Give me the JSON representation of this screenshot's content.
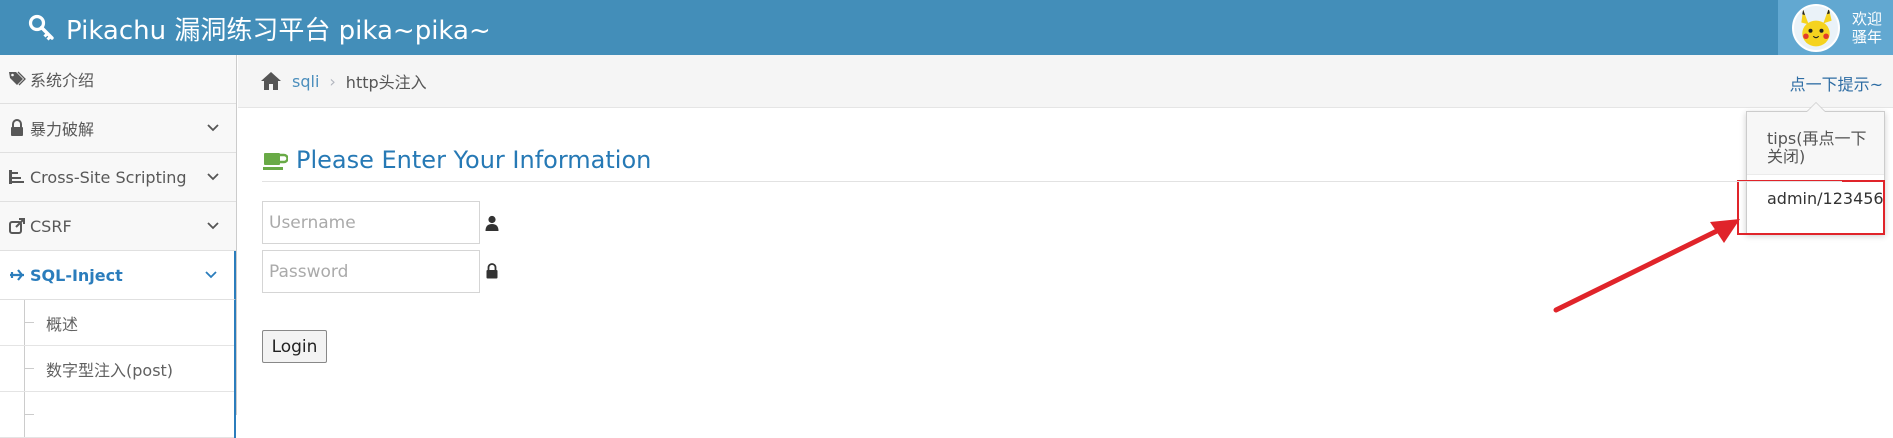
{
  "navbar": {
    "brand": "Pikachu 漏洞练习平台 pika~pika~",
    "brand_icon": "key-icon",
    "welcome_line1": "欢迎",
    "welcome_line2": "骚年",
    "background": "#438eb9"
  },
  "sidebar": {
    "items": [
      {
        "label": "系统介绍",
        "icon": "tags-icon",
        "expandable": false
      },
      {
        "label": "暴力破解",
        "icon": "lock-icon",
        "expandable": true
      },
      {
        "label": "Cross-Site Scripting",
        "icon": "sitemap-icon",
        "expandable": true
      },
      {
        "label": "CSRF",
        "icon": "share-icon",
        "expandable": true
      },
      {
        "label": "SQL-Inject",
        "icon": "plane-icon",
        "expandable": true,
        "active": true
      }
    ],
    "sub_items": [
      {
        "label": "概述"
      },
      {
        "label": "数字型注入(post)"
      },
      {
        "label": ""
      }
    ],
    "active_color": "#2b7dbc"
  },
  "breadcrumb": {
    "link": "sqli",
    "current": "http头注入",
    "hint_link": "点一下提示~"
  },
  "popover": {
    "title": "tips(再点一下关闭)",
    "content": "admin/123456",
    "highlight_color": "#e0242a"
  },
  "main": {
    "header": "Please Enter Your Information",
    "username_placeholder": "Username",
    "password_placeholder": "Password",
    "login_label": "Login",
    "header_color": "#2679b5"
  }
}
